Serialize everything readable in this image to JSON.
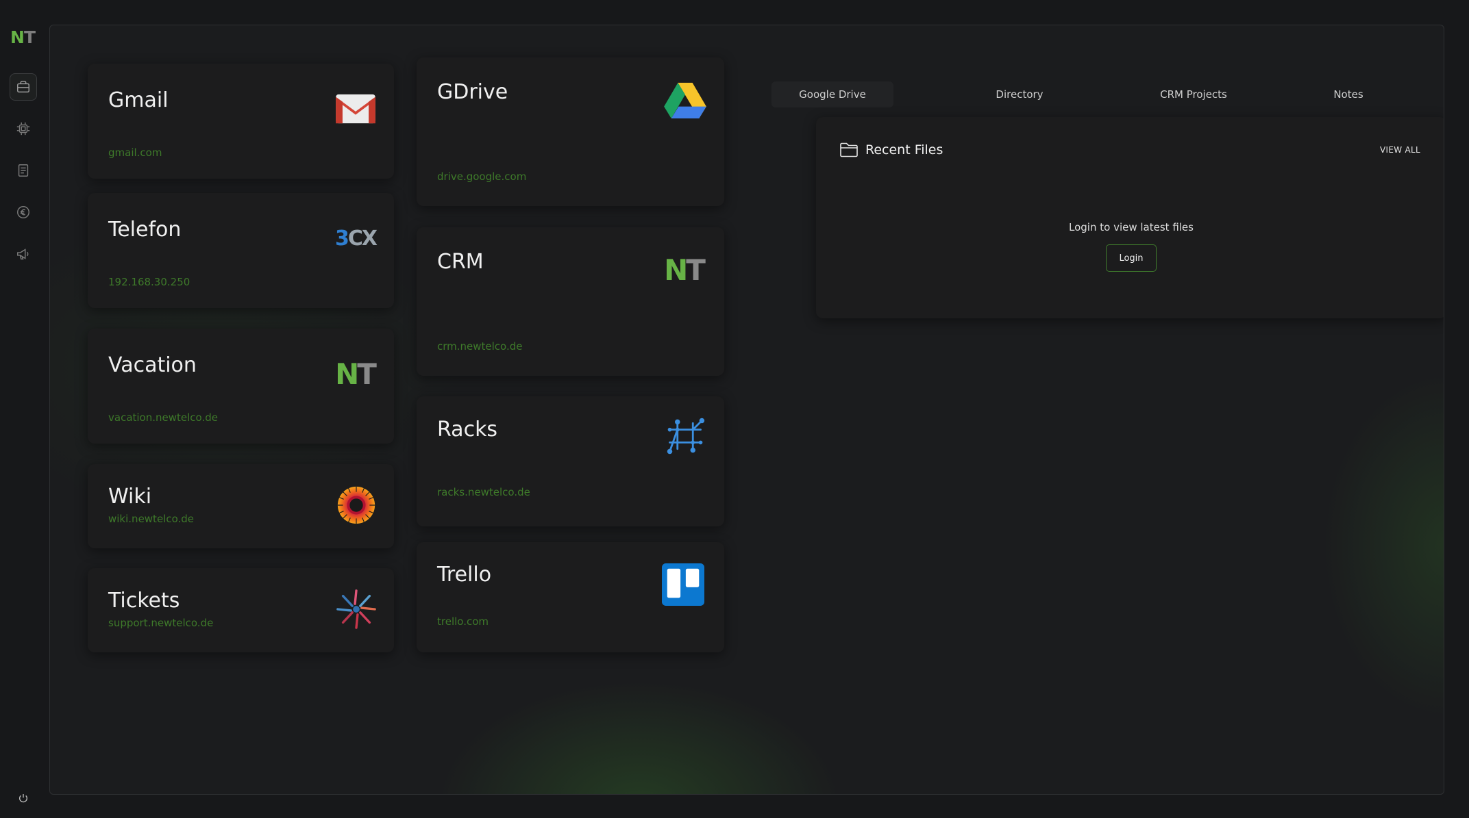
{
  "brand": {
    "logo_n": "N",
    "logo_t": "T"
  },
  "sidebar": {
    "items": [
      {
        "name": "briefcase-icon"
      },
      {
        "name": "chip-icon"
      },
      {
        "name": "document-icon"
      },
      {
        "name": "euro-icon"
      },
      {
        "name": "megaphone-icon"
      }
    ],
    "power_icon": "power-icon"
  },
  "apps": [
    {
      "title": "Gmail",
      "url": "gmail.com",
      "icon": "gmail-icon"
    },
    {
      "title": "Telefon",
      "url": "192.168.30.250",
      "icon": "3cx-icon",
      "icon_text_a": "3",
      "icon_text_b": "CX"
    },
    {
      "title": "Vacation",
      "url": "vacation.newtelco.de",
      "icon": "newtelco-icon",
      "icon_text_a": "N",
      "icon_text_b": "T"
    },
    {
      "title": "Wiki",
      "url": "wiki.newtelco.de",
      "icon": "wiki-icon"
    },
    {
      "title": "Tickets",
      "url": "support.newtelco.de",
      "icon": "tickets-icon"
    },
    {
      "title": "GDrive",
      "url": "drive.google.com",
      "icon": "gdrive-icon"
    },
    {
      "title": "CRM",
      "url": "crm.newtelco.de",
      "icon": "newtelco-icon",
      "icon_text_a": "N",
      "icon_text_b": "T"
    },
    {
      "title": "Racks",
      "url": "racks.newtelco.de",
      "icon": "racks-icon"
    },
    {
      "title": "Trello",
      "url": "trello.com",
      "icon": "trello-icon"
    }
  ],
  "tabs": [
    {
      "label": "Google Drive",
      "active": true
    },
    {
      "label": "Directory",
      "active": false
    },
    {
      "label": "CRM Projects",
      "active": false
    },
    {
      "label": "Notes",
      "active": false
    }
  ],
  "files": {
    "title": "Recent Files",
    "view_all": "VIEW ALL",
    "message": "Login to view latest files",
    "login_label": "Login"
  },
  "colors": {
    "accent": "#67b346",
    "url_text": "#3e7a2a"
  }
}
